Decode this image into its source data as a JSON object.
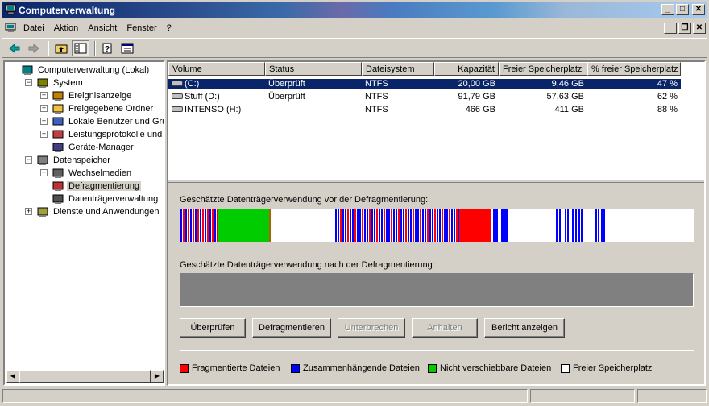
{
  "window": {
    "title": "Computerverwaltung"
  },
  "menu": {
    "items": [
      "Datei",
      "Aktion",
      "Ansicht",
      "Fenster",
      "?"
    ]
  },
  "tree": {
    "items": [
      {
        "label": "Computerverwaltung (Lokal)",
        "level": 0,
        "expander": "",
        "icon": "computer-icon"
      },
      {
        "label": "System",
        "level": 1,
        "expander": "−",
        "icon": "tools-icon"
      },
      {
        "label": "Ereignisanzeige",
        "level": 2,
        "expander": "+",
        "icon": "event-viewer-icon"
      },
      {
        "label": "Freigegebene Ordner",
        "level": 2,
        "expander": "+",
        "icon": "shared-folder-icon"
      },
      {
        "label": "Lokale Benutzer und Gruppe",
        "level": 2,
        "expander": "+",
        "icon": "users-icon"
      },
      {
        "label": "Leistungsprotokolle und War",
        "level": 2,
        "expander": "+",
        "icon": "performance-icon"
      },
      {
        "label": "Geräte-Manager",
        "level": 2,
        "expander": "",
        "icon": "device-manager-icon"
      },
      {
        "label": "Datenspeicher",
        "level": 1,
        "expander": "−",
        "icon": "storage-icon"
      },
      {
        "label": "Wechselmedien",
        "level": 2,
        "expander": "+",
        "icon": "removable-media-icon"
      },
      {
        "label": "Defragmentierung",
        "level": 2,
        "expander": "",
        "icon": "defrag-icon",
        "selected": true
      },
      {
        "label": "Datenträgerverwaltung",
        "level": 2,
        "expander": "",
        "icon": "disk-management-icon"
      },
      {
        "label": "Dienste und Anwendungen",
        "level": 1,
        "expander": "+",
        "icon": "services-icon"
      }
    ]
  },
  "volumes": {
    "columns": [
      "Volume",
      "Status",
      "Dateisystem",
      "Kapazität",
      "Freier Speicherplatz",
      "% freier Speicherplatz"
    ],
    "rows": [
      {
        "volume": "(C:)",
        "status": "Überprüft",
        "fs": "NTFS",
        "capacity": "20,00 GB",
        "free": "9,46 GB",
        "pct": "47 %",
        "selected": true
      },
      {
        "volume": "Stuff (D:)",
        "status": "Überprüft",
        "fs": "NTFS",
        "capacity": "91,79 GB",
        "free": "57,63 GB",
        "pct": "62 %"
      },
      {
        "volume": "INTENSO (H:)",
        "status": "",
        "fs": "NTFS",
        "capacity": "466 GB",
        "free": "411 GB",
        "pct": "88 %"
      }
    ]
  },
  "defrag": {
    "before_label": "Geschätzte Datenträgerverwendung vor der Defragmentierung:",
    "after_label": "Geschätzte Datenträgerverwendung nach der Defragmentierung:",
    "buttons": {
      "analyze": "Überprüfen",
      "defragment": "Defragmentieren",
      "pause": "Unterbrechen",
      "stop": "Anhalten",
      "report": "Bericht anzeigen"
    },
    "legend": {
      "fragmented": "Fragmentierte Dateien",
      "contiguous": "Zusammenhängende Dateien",
      "unmovable": "Nicht verschiebbare Dateien",
      "free": "Freier Speicherplatz"
    },
    "colors": {
      "fragmented": "#ff0000",
      "contiguous": "#0000ff",
      "unmovable": "#00cc00",
      "free": "#ffffff",
      "after_empty": "#808080"
    }
  }
}
